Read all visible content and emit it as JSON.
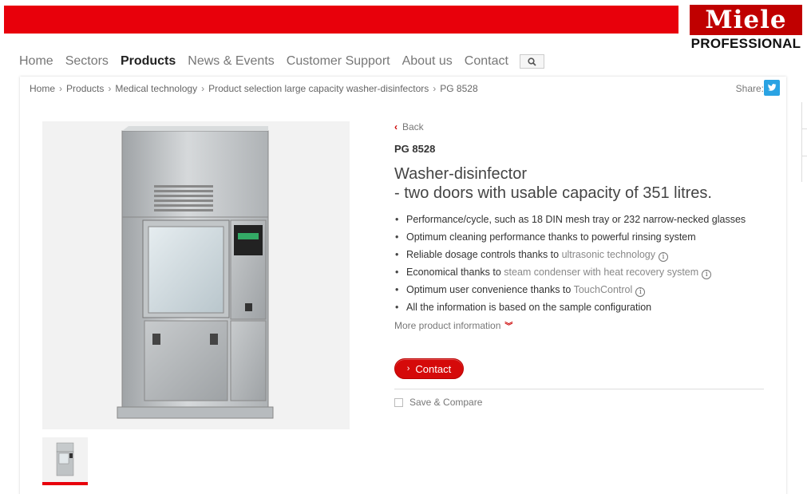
{
  "brand": {
    "logo_main": "Miele",
    "logo_sub": "PROFESSIONAL",
    "accent": "#e8000b"
  },
  "nav": {
    "items": [
      {
        "label": "Home"
      },
      {
        "label": "Sectors"
      },
      {
        "label": "Products"
      },
      {
        "label": "News & Events"
      },
      {
        "label": "Customer Support"
      },
      {
        "label": "About us"
      },
      {
        "label": "Contact"
      }
    ],
    "active": "Products",
    "search_icon": "search-icon"
  },
  "breadcrumb": {
    "items": [
      "Home",
      "Products",
      "Medical technology",
      "Product selection large capacity washer-disinfectors",
      "PG 8528"
    ],
    "separator": "›"
  },
  "share": {
    "label": "Share:",
    "icon": "twitter-icon"
  },
  "product": {
    "back_label": "Back",
    "model": "PG 8528",
    "headline_line1": "Washer-disinfector",
    "headline_line2": "- two doors with usable capacity of 351 litres.",
    "features": [
      {
        "text": "Performance/cycle, such as 18 DIN mesh tray or 232 narrow-necked glasses"
      },
      {
        "text": "Optimum cleaning performance thanks to powerful rinsing system"
      },
      {
        "text": "Reliable dosage controls thanks to ",
        "link": "ultrasonic technology"
      },
      {
        "text": "Economical thanks to ",
        "link": "steam condenser with heat recovery system"
      },
      {
        "text": "Optimum user convenience thanks to ",
        "link": "TouchControl"
      },
      {
        "text": "All the information is based on the sample configuration"
      }
    ],
    "more_info_label": "More product information",
    "contact_label": "Contact",
    "save_compare_label": "Save & Compare",
    "display_brand": "Miele"
  }
}
